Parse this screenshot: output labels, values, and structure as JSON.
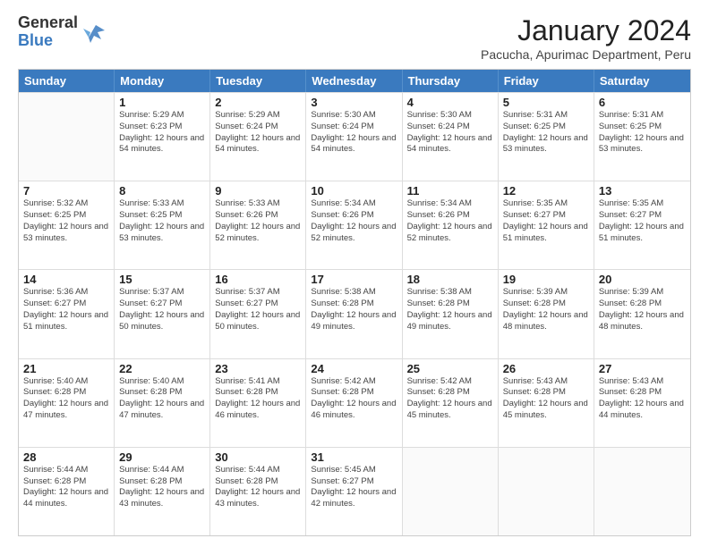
{
  "logo": {
    "general": "General",
    "blue": "Blue"
  },
  "header": {
    "month_title": "January 2024",
    "subtitle": "Pacucha, Apurimac Department, Peru"
  },
  "days_of_week": [
    "Sunday",
    "Monday",
    "Tuesday",
    "Wednesday",
    "Thursday",
    "Friday",
    "Saturday"
  ],
  "weeks": [
    [
      {
        "day": "",
        "sunrise": "",
        "sunset": "",
        "daylight": ""
      },
      {
        "day": "1",
        "sunrise": "Sunrise: 5:29 AM",
        "sunset": "Sunset: 6:23 PM",
        "daylight": "Daylight: 12 hours and 54 minutes."
      },
      {
        "day": "2",
        "sunrise": "Sunrise: 5:29 AM",
        "sunset": "Sunset: 6:24 PM",
        "daylight": "Daylight: 12 hours and 54 minutes."
      },
      {
        "day": "3",
        "sunrise": "Sunrise: 5:30 AM",
        "sunset": "Sunset: 6:24 PM",
        "daylight": "Daylight: 12 hours and 54 minutes."
      },
      {
        "day": "4",
        "sunrise": "Sunrise: 5:30 AM",
        "sunset": "Sunset: 6:24 PM",
        "daylight": "Daylight: 12 hours and 54 minutes."
      },
      {
        "day": "5",
        "sunrise": "Sunrise: 5:31 AM",
        "sunset": "Sunset: 6:25 PM",
        "daylight": "Daylight: 12 hours and 53 minutes."
      },
      {
        "day": "6",
        "sunrise": "Sunrise: 5:31 AM",
        "sunset": "Sunset: 6:25 PM",
        "daylight": "Daylight: 12 hours and 53 minutes."
      }
    ],
    [
      {
        "day": "7",
        "sunrise": "Sunrise: 5:32 AM",
        "sunset": "Sunset: 6:25 PM",
        "daylight": "Daylight: 12 hours and 53 minutes."
      },
      {
        "day": "8",
        "sunrise": "Sunrise: 5:33 AM",
        "sunset": "Sunset: 6:25 PM",
        "daylight": "Daylight: 12 hours and 53 minutes."
      },
      {
        "day": "9",
        "sunrise": "Sunrise: 5:33 AM",
        "sunset": "Sunset: 6:26 PM",
        "daylight": "Daylight: 12 hours and 52 minutes."
      },
      {
        "day": "10",
        "sunrise": "Sunrise: 5:34 AM",
        "sunset": "Sunset: 6:26 PM",
        "daylight": "Daylight: 12 hours and 52 minutes."
      },
      {
        "day": "11",
        "sunrise": "Sunrise: 5:34 AM",
        "sunset": "Sunset: 6:26 PM",
        "daylight": "Daylight: 12 hours and 52 minutes."
      },
      {
        "day": "12",
        "sunrise": "Sunrise: 5:35 AM",
        "sunset": "Sunset: 6:27 PM",
        "daylight": "Daylight: 12 hours and 51 minutes."
      },
      {
        "day": "13",
        "sunrise": "Sunrise: 5:35 AM",
        "sunset": "Sunset: 6:27 PM",
        "daylight": "Daylight: 12 hours and 51 minutes."
      }
    ],
    [
      {
        "day": "14",
        "sunrise": "Sunrise: 5:36 AM",
        "sunset": "Sunset: 6:27 PM",
        "daylight": "Daylight: 12 hours and 51 minutes."
      },
      {
        "day": "15",
        "sunrise": "Sunrise: 5:37 AM",
        "sunset": "Sunset: 6:27 PM",
        "daylight": "Daylight: 12 hours and 50 minutes."
      },
      {
        "day": "16",
        "sunrise": "Sunrise: 5:37 AM",
        "sunset": "Sunset: 6:27 PM",
        "daylight": "Daylight: 12 hours and 50 minutes."
      },
      {
        "day": "17",
        "sunrise": "Sunrise: 5:38 AM",
        "sunset": "Sunset: 6:28 PM",
        "daylight": "Daylight: 12 hours and 49 minutes."
      },
      {
        "day": "18",
        "sunrise": "Sunrise: 5:38 AM",
        "sunset": "Sunset: 6:28 PM",
        "daylight": "Daylight: 12 hours and 49 minutes."
      },
      {
        "day": "19",
        "sunrise": "Sunrise: 5:39 AM",
        "sunset": "Sunset: 6:28 PM",
        "daylight": "Daylight: 12 hours and 48 minutes."
      },
      {
        "day": "20",
        "sunrise": "Sunrise: 5:39 AM",
        "sunset": "Sunset: 6:28 PM",
        "daylight": "Daylight: 12 hours and 48 minutes."
      }
    ],
    [
      {
        "day": "21",
        "sunrise": "Sunrise: 5:40 AM",
        "sunset": "Sunset: 6:28 PM",
        "daylight": "Daylight: 12 hours and 47 minutes."
      },
      {
        "day": "22",
        "sunrise": "Sunrise: 5:40 AM",
        "sunset": "Sunset: 6:28 PM",
        "daylight": "Daylight: 12 hours and 47 minutes."
      },
      {
        "day": "23",
        "sunrise": "Sunrise: 5:41 AM",
        "sunset": "Sunset: 6:28 PM",
        "daylight": "Daylight: 12 hours and 46 minutes."
      },
      {
        "day": "24",
        "sunrise": "Sunrise: 5:42 AM",
        "sunset": "Sunset: 6:28 PM",
        "daylight": "Daylight: 12 hours and 46 minutes."
      },
      {
        "day": "25",
        "sunrise": "Sunrise: 5:42 AM",
        "sunset": "Sunset: 6:28 PM",
        "daylight": "Daylight: 12 hours and 45 minutes."
      },
      {
        "day": "26",
        "sunrise": "Sunrise: 5:43 AM",
        "sunset": "Sunset: 6:28 PM",
        "daylight": "Daylight: 12 hours and 45 minutes."
      },
      {
        "day": "27",
        "sunrise": "Sunrise: 5:43 AM",
        "sunset": "Sunset: 6:28 PM",
        "daylight": "Daylight: 12 hours and 44 minutes."
      }
    ],
    [
      {
        "day": "28",
        "sunrise": "Sunrise: 5:44 AM",
        "sunset": "Sunset: 6:28 PM",
        "daylight": "Daylight: 12 hours and 44 minutes."
      },
      {
        "day": "29",
        "sunrise": "Sunrise: 5:44 AM",
        "sunset": "Sunset: 6:28 PM",
        "daylight": "Daylight: 12 hours and 43 minutes."
      },
      {
        "day": "30",
        "sunrise": "Sunrise: 5:44 AM",
        "sunset": "Sunset: 6:28 PM",
        "daylight": "Daylight: 12 hours and 43 minutes."
      },
      {
        "day": "31",
        "sunrise": "Sunrise: 5:45 AM",
        "sunset": "Sunset: 6:27 PM",
        "daylight": "Daylight: 12 hours and 42 minutes."
      },
      {
        "day": "",
        "sunrise": "",
        "sunset": "",
        "daylight": ""
      },
      {
        "day": "",
        "sunrise": "",
        "sunset": "",
        "daylight": ""
      },
      {
        "day": "",
        "sunrise": "",
        "sunset": "",
        "daylight": ""
      }
    ]
  ]
}
